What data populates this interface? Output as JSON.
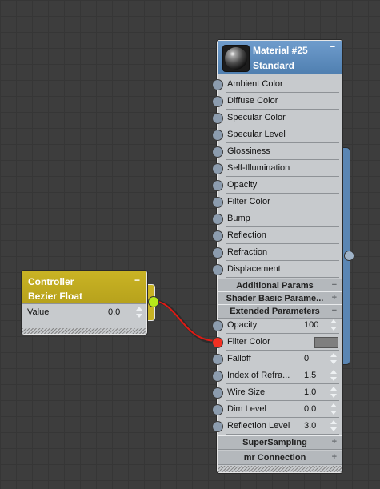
{
  "controller": {
    "title_line1": "Controller",
    "title_line2": "Bezier Float",
    "minimize": "−",
    "value_label": "Value",
    "value": "0.0",
    "header_color": "#c9b324"
  },
  "material": {
    "title_line1": "Material #25",
    "title_line2": "Standard",
    "minimize": "−",
    "header_color": "#5a86b4",
    "slots": [
      {
        "label": "Ambient Color"
      },
      {
        "label": "Diffuse Color"
      },
      {
        "label": "Specular Color"
      },
      {
        "label": "Specular Level"
      },
      {
        "label": "Glossiness"
      },
      {
        "label": "Self-Illumination"
      },
      {
        "label": "Opacity"
      },
      {
        "label": "Filter Color"
      },
      {
        "label": "Bump"
      },
      {
        "label": "Reflection"
      },
      {
        "label": "Refraction"
      },
      {
        "label": "Displacement"
      }
    ],
    "groups": {
      "additional": {
        "label": "Additional Params",
        "toggle": "−"
      },
      "shader": {
        "label": "Shader  Basic  Parame...",
        "toggle": "+"
      },
      "extended": {
        "label": "Extended Parameters",
        "toggle": "−"
      },
      "supersampling": {
        "label": "SuperSampling",
        "toggle": "+"
      },
      "mr": {
        "label": "mr Connection",
        "toggle": "+"
      }
    },
    "extended_params": [
      {
        "label": "Opacity",
        "value": "100"
      },
      {
        "label": "Filter Color",
        "value": ""
      },
      {
        "label": "Falloff",
        "value": "0"
      },
      {
        "label": "Index of Refra...",
        "value": "1.5"
      },
      {
        "label": "Wire Size",
        "value": "1.0"
      },
      {
        "label": "Dim Level",
        "value": "0.0"
      },
      {
        "label": "Reflection Level",
        "value": "3.0"
      }
    ]
  }
}
